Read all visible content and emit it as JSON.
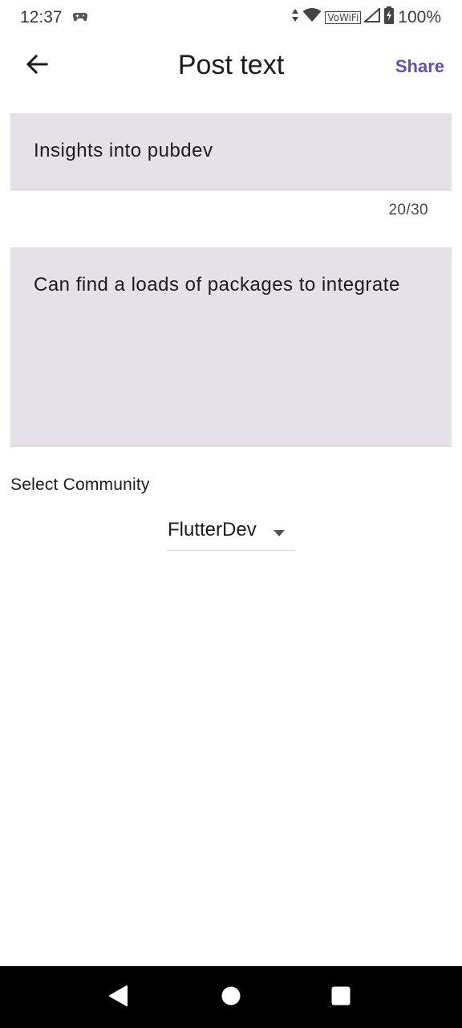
{
  "status_bar": {
    "time": "12:37",
    "vowifi": "VoWiFi",
    "battery": "100%"
  },
  "app_bar": {
    "title": "Post text",
    "share_label": "Share"
  },
  "post_title": {
    "value": "Insights into pubdev",
    "counter": "20/30"
  },
  "post_body": {
    "value": "Can find a loads of packages to integrate"
  },
  "community": {
    "label": "Select Community",
    "selected": "FlutterDev"
  },
  "colors": {
    "accent": "#6750a4",
    "field_background": "#e6e0e9",
    "nav_bar": "#000000"
  },
  "icons": {
    "back": "arrow-left-icon",
    "dropdown": "caret-down-icon",
    "nav_back": "triangle-back-icon",
    "nav_home": "circle-home-icon",
    "nav_recent": "square-recent-icon"
  }
}
